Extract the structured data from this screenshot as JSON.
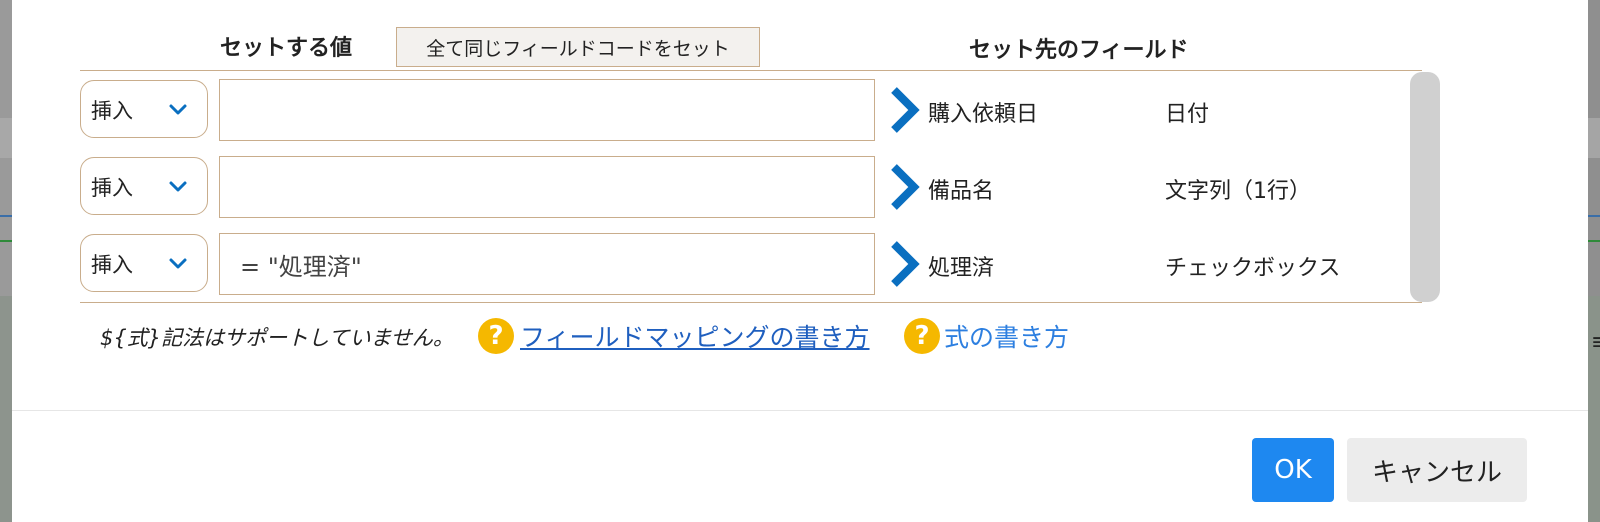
{
  "header": {
    "value_column": "セットする値",
    "set_all_button": "全て同じフィールドコードをセット",
    "field_column": "セット先のフィールド"
  },
  "rows": [
    {
      "mode": "挿入",
      "value": "",
      "field_name": "購入依頼日",
      "field_type": "日付"
    },
    {
      "mode": "挿入",
      "value": "",
      "field_name": "備品名",
      "field_type": "文字列（1行）"
    },
    {
      "mode": "挿入",
      "value": "= \"処理済\"",
      "field_name": "処理済",
      "field_type": "チェックボックス"
    }
  ],
  "footer_note": {
    "text": "${式}記法はサポートしていません。",
    "help_icon_glyph": "?",
    "link_mapping": "フィールドマッピングの書き方",
    "link_formula": "式の書き方"
  },
  "buttons": {
    "ok": "OK",
    "cancel": "キャンセル"
  },
  "colors": {
    "accent_blue": "#1e88f0",
    "arrow_blue": "#0a6fc0",
    "help_yellow": "#f5b800",
    "border_tan": "#c9ad8c"
  },
  "icons": {
    "mode_dropdown": "chevron-down-icon",
    "row_arrow": "chevron-right-icon",
    "help": "question-circle-icon"
  }
}
